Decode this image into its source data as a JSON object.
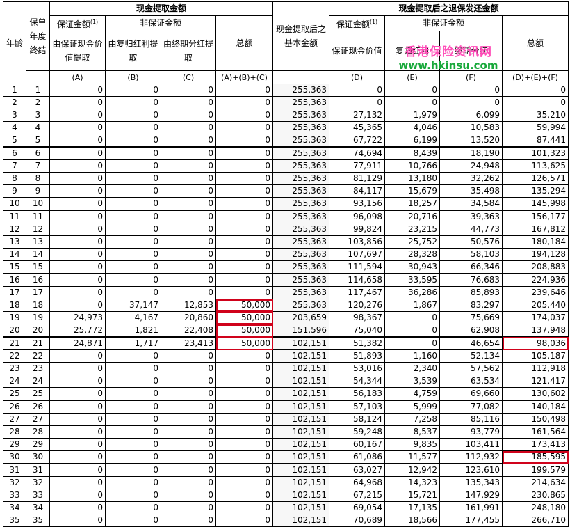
{
  "header": {
    "age": "年龄",
    "policy_year": "保单年度终结",
    "withdraw_group": "现金提取金额",
    "guaranteed_group": "保证金额",
    "guaranteed_group_sup": "(1)",
    "non_guaranteed_group": "非保证金额",
    "col_a": "由保证现金价值提取",
    "col_b": "由复归红利提取",
    "col_c": "由终期分红提取",
    "col_total": "总额",
    "col_basic": "现金提取后之基本金额",
    "after_group": "现金提取后之退保发还金额",
    "col_d_guaranteed": "保证金额",
    "col_d_guaranteed_sup": "(1)",
    "col_d": "保证现金价值",
    "non_guaranteed_group_2": "非保证金额",
    "col_e": "复归红利",
    "col_f": "终期分红",
    "col_total_2": "总额",
    "abbr_a": "(A)",
    "abbr_b": "(B)",
    "abbr_c": "(C)",
    "abbr_abc": "(A)+(B)+(C)",
    "abbr_d": "(D)",
    "abbr_e": "(E)",
    "abbr_f": "(F)",
    "abbr_def": "(D)+(E)+(F)"
  },
  "watermark": {
    "line1": "香港保险资讯网",
    "line2": "www.hkinsu.com"
  },
  "highlight_color": "#d0021b",
  "rows": [
    [
      "1",
      "1",
      "0",
      "0",
      "0",
      "0",
      "255,363",
      "0",
      "0",
      "0",
      "0"
    ],
    [
      "2",
      "2",
      "0",
      "0",
      "0",
      "0",
      "255,363",
      "0",
      "0",
      "0",
      "0"
    ],
    [
      "3",
      "3",
      "0",
      "0",
      "0",
      "0",
      "255,363",
      "27,132",
      "1,979",
      "6,099",
      "35,210"
    ],
    [
      "4",
      "4",
      "0",
      "0",
      "0",
      "0",
      "255,363",
      "45,365",
      "4,046",
      "10,583",
      "59,994"
    ],
    [
      "5",
      "5",
      "0",
      "0",
      "0",
      "0",
      "255,363",
      "67,722",
      "6,199",
      "13,520",
      "87,441"
    ],
    [
      "6",
      "6",
      "0",
      "0",
      "0",
      "0",
      "255,363",
      "74,694",
      "8,439",
      "18,190",
      "101,323"
    ],
    [
      "7",
      "7",
      "0",
      "0",
      "0",
      "0",
      "255,363",
      "77,911",
      "10,766",
      "24,948",
      "113,625"
    ],
    [
      "8",
      "8",
      "0",
      "0",
      "0",
      "0",
      "255,363",
      "81,129",
      "13,180",
      "32,262",
      "126,571"
    ],
    [
      "9",
      "9",
      "0",
      "0",
      "0",
      "0",
      "255,363",
      "84,117",
      "15,679",
      "35,498",
      "135,294"
    ],
    [
      "10",
      "10",
      "0",
      "0",
      "0",
      "0",
      "255,363",
      "93,156",
      "18,257",
      "34,584",
      "145,998"
    ],
    [
      "11",
      "11",
      "0",
      "0",
      "0",
      "0",
      "255,363",
      "96,098",
      "20,716",
      "39,363",
      "156,177"
    ],
    [
      "12",
      "12",
      "0",
      "0",
      "0",
      "0",
      "255,363",
      "99,824",
      "23,215",
      "44,773",
      "167,812"
    ],
    [
      "13",
      "13",
      "0",
      "0",
      "0",
      "0",
      "255,363",
      "103,856",
      "25,752",
      "50,576",
      "180,184"
    ],
    [
      "14",
      "14",
      "0",
      "0",
      "0",
      "0",
      "255,363",
      "107,697",
      "28,328",
      "58,103",
      "194,128"
    ],
    [
      "15",
      "15",
      "0",
      "0",
      "0",
      "0",
      "255,363",
      "111,594",
      "30,943",
      "66,346",
      "208,883"
    ],
    [
      "16",
      "16",
      "0",
      "0",
      "0",
      "0",
      "255,363",
      "114,658",
      "33,595",
      "76,683",
      "224,936"
    ],
    [
      "17",
      "17",
      "0",
      "0",
      "0",
      "0",
      "255,363",
      "117,467",
      "36,286",
      "85,893",
      "239,646"
    ],
    [
      "18",
      "18",
      "0",
      "37,147",
      "12,853",
      "50,000",
      "255,363",
      "120,276",
      "1,867",
      "83,297",
      "205,440"
    ],
    [
      "19",
      "19",
      "24,973",
      "4,167",
      "20,860",
      "50,000",
      "203,659",
      "98,367",
      "0",
      "75,669",
      "174,037"
    ],
    [
      "20",
      "20",
      "25,772",
      "1,821",
      "22,408",
      "50,000",
      "151,596",
      "75,040",
      "0",
      "62,908",
      "137,948"
    ],
    [
      "21",
      "21",
      "24,871",
      "1,717",
      "23,413",
      "50,000",
      "102,151",
      "51,382",
      "0",
      "46,654",
      "98,036"
    ],
    [
      "22",
      "22",
      "0",
      "0",
      "0",
      "0",
      "102,151",
      "51,893",
      "1,160",
      "52,134",
      "105,187"
    ],
    [
      "23",
      "23",
      "0",
      "0",
      "0",
      "0",
      "102,151",
      "53,016",
      "2,340",
      "57,562",
      "112,918"
    ],
    [
      "24",
      "24",
      "0",
      "0",
      "0",
      "0",
      "102,151",
      "54,344",
      "3,539",
      "63,534",
      "121,417"
    ],
    [
      "25",
      "25",
      "0",
      "0",
      "0",
      "0",
      "102,151",
      "56,183",
      "4,759",
      "69,660",
      "130,602"
    ],
    [
      "26",
      "26",
      "0",
      "0",
      "0",
      "0",
      "102,151",
      "57,103",
      "5,999",
      "77,082",
      "140,184"
    ],
    [
      "27",
      "27",
      "0",
      "0",
      "0",
      "0",
      "102,151",
      "58,124",
      "7,258",
      "85,116",
      "150,498"
    ],
    [
      "28",
      "28",
      "0",
      "0",
      "0",
      "0",
      "102,151",
      "59,248",
      "8,537",
      "93,779",
      "161,564"
    ],
    [
      "29",
      "29",
      "0",
      "0",
      "0",
      "0",
      "102,151",
      "60,167",
      "9,835",
      "103,411",
      "173,413"
    ],
    [
      "30",
      "30",
      "0",
      "0",
      "0",
      "0",
      "102,151",
      "61,086",
      "11,577",
      "112,932",
      "185,595"
    ],
    [
      "31",
      "31",
      "0",
      "0",
      "0",
      "0",
      "102,151",
      "63,027",
      "12,942",
      "123,610",
      "199,579"
    ],
    [
      "32",
      "32",
      "0",
      "0",
      "0",
      "0",
      "102,151",
      "64,968",
      "14,323",
      "135,343",
      "214,634"
    ],
    [
      "33",
      "33",
      "0",
      "0",
      "0",
      "0",
      "102,151",
      "67,215",
      "15,721",
      "147,929",
      "230,865"
    ],
    [
      "34",
      "34",
      "0",
      "0",
      "0",
      "0",
      "102,151",
      "69,054",
      "17,135",
      "161,991",
      "248,180"
    ],
    [
      "35",
      "35",
      "0",
      "0",
      "0",
      "0",
      "102,151",
      "70,689",
      "18,566",
      "177,455",
      "266,710"
    ]
  ],
  "highlighted_cells": [
    [
      17,
      5
    ],
    [
      18,
      5
    ],
    [
      19,
      5
    ],
    [
      20,
      5
    ],
    [
      20,
      10
    ],
    [
      29,
      10
    ]
  ]
}
